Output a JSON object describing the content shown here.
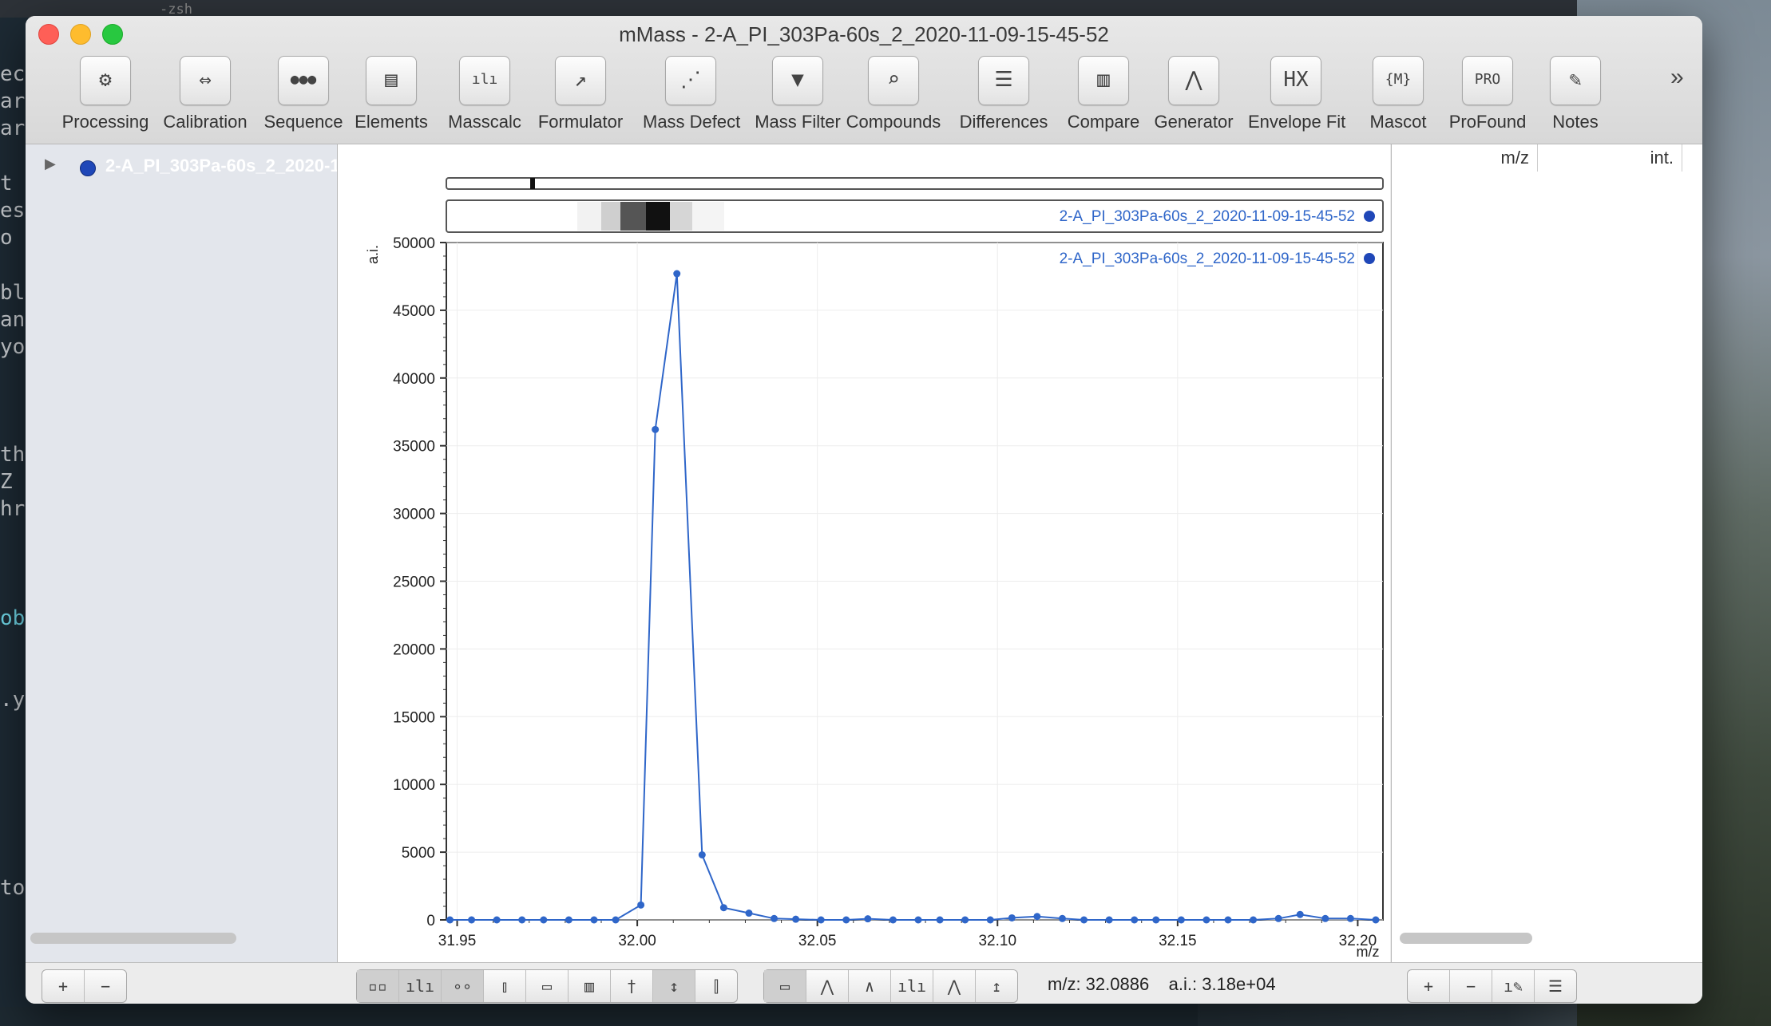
{
  "window": {
    "title": "mMass - 2-A_PI_303Pa-60s_2_2020-11-09-15-45-52"
  },
  "background_terminal": {
    "tab_label": "-zsh",
    "lines": [
      "ec",
      "ar",
      "ar",
      "t",
      "es",
      "o",
      "bl",
      "an",
      "yo",
      "th",
      "Z",
      "hr",
      "ob",
      ".y",
      "to"
    ]
  },
  "toolbar": {
    "items": [
      {
        "label": "Processing",
        "icon": "gear-icon",
        "glyph": "⚙"
      },
      {
        "label": "Calibration",
        "icon": "calibration-icon",
        "glyph": "⇔"
      },
      {
        "label": "Sequence",
        "icon": "sequence-icon",
        "glyph": "●●●"
      },
      {
        "label": "Elements",
        "icon": "elements-icon",
        "glyph": "▤"
      },
      {
        "label": "Masscalc",
        "icon": "masscalc-icon",
        "glyph": "ılı"
      },
      {
        "label": "Formulator",
        "icon": "formulator-icon",
        "glyph": "↗"
      },
      {
        "label": "Mass Defect",
        "icon": "mass-defect-icon",
        "glyph": "⋰"
      },
      {
        "label": "Mass Filter",
        "icon": "mass-filter-icon",
        "glyph": "▼"
      },
      {
        "label": "Compounds",
        "icon": "compounds-icon",
        "glyph": "⌕"
      },
      {
        "label": "Differences",
        "icon": "differences-icon",
        "glyph": "☰"
      },
      {
        "label": "Compare",
        "icon": "compare-icon",
        "glyph": "▥"
      },
      {
        "label": "Generator",
        "icon": "generator-icon",
        "glyph": "⋀"
      },
      {
        "label": "Envelope Fit",
        "icon": "envelope-fit-icon",
        "glyph": "HX"
      },
      {
        "label": "Mascot",
        "icon": "mascot-icon",
        "glyph": "{M}"
      },
      {
        "label": "ProFound",
        "icon": "profound-icon",
        "glyph": "PRO"
      },
      {
        "label": "Notes",
        "icon": "notes-icon",
        "glyph": "✎"
      }
    ],
    "overflow": "»"
  },
  "documents": [
    {
      "name": "2-A_PI_303Pa-60s_2_2020-11-09-15-45-52",
      "color": "#1f47b8"
    }
  ],
  "peaklist": {
    "col_mz": "m/z",
    "col_int": "int."
  },
  "colors": {
    "series": "#2f66c9",
    "accent_dot": "#1f47b8"
  },
  "status": {
    "mz_label": "m/z: 32.0886",
    "ai_label": "a.i.: 3.18e+04"
  },
  "bottom_left_buttons": [
    "+",
    "−"
  ],
  "bottom_right_buttons": [
    "+",
    "−",
    "peak-edit-icon",
    "notes-edit-icon"
  ],
  "chart_data": {
    "type": "line",
    "title": "",
    "xlabel": "m/z",
    "ylabel": "a.i.",
    "xlim": [
      31.947,
      32.207
    ],
    "ylim": [
      0,
      50000
    ],
    "x_ticks": [
      "31.95",
      "32.00",
      "32.05",
      "32.10",
      "32.15",
      "32.20"
    ],
    "y_ticks": [
      "0",
      "5000",
      "10000",
      "15000",
      "20000",
      "25000",
      "30000",
      "35000",
      "40000",
      "45000",
      "50000"
    ],
    "grid": true,
    "legend": "top-right",
    "series": [
      {
        "name": "2-A_PI_303Pa-60s_2_2020-11-09-15-45-52",
        "x": [
          31.948,
          31.954,
          31.961,
          31.968,
          31.974,
          31.981,
          31.988,
          31.994,
          32.001,
          32.005,
          32.011,
          32.018,
          32.024,
          32.031,
          32.038,
          32.044,
          32.051,
          32.058,
          32.064,
          32.071,
          32.078,
          32.084,
          32.091,
          32.098,
          32.104,
          32.111,
          32.118,
          32.124,
          32.131,
          32.138,
          32.144,
          32.151,
          32.158,
          32.164,
          32.171,
          32.178,
          32.184,
          32.191,
          32.198,
          32.205
        ],
        "y": [
          0,
          0,
          0,
          0,
          0,
          0,
          0,
          0,
          1100,
          36200,
          47700,
          4800,
          900,
          500,
          100,
          50,
          0,
          0,
          80,
          0,
          0,
          0,
          0,
          0,
          150,
          250,
          100,
          0,
          0,
          0,
          0,
          0,
          0,
          0,
          0,
          100,
          400,
          100,
          100,
          0
        ]
      }
    ]
  }
}
